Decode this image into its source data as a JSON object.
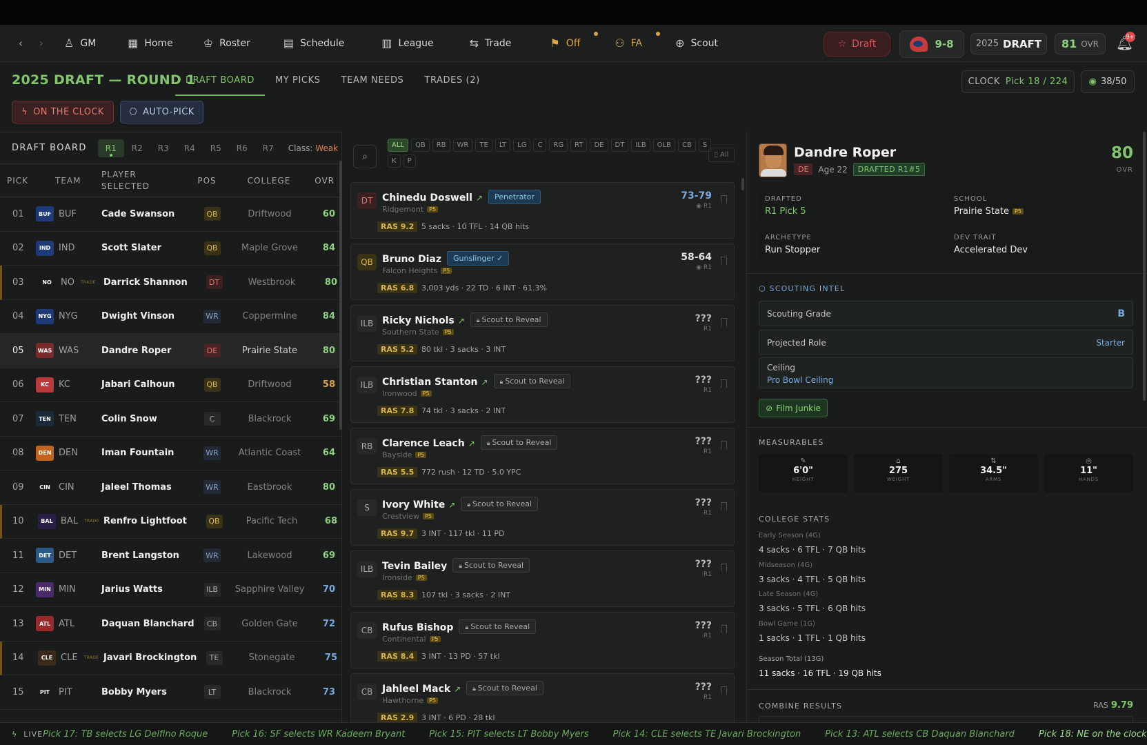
{
  "nav": {
    "gm": "GM",
    "home": "Home",
    "roster": "Roster",
    "schedule": "Schedule",
    "league": "League",
    "trade": "Trade",
    "off": "Off",
    "fa": "FA",
    "scout": "Scout",
    "draft": "Draft",
    "record": "9-8",
    "year": "2025",
    "year_label": "DRAFT",
    "ovr": "81",
    "ovr_label": "OVR",
    "notif_badge": "9+"
  },
  "header": {
    "title": "2025 DRAFT — ROUND 1",
    "tabs": [
      "DRAFT BOARD",
      "MY PICKS",
      "TEAM NEEDS",
      "TRADES (2)"
    ],
    "clock_label": "CLOCK",
    "clock_value": "Pick 18 / 224",
    "watch": "38/50",
    "on_clock": "ON THE CLOCK",
    "auto_pick": "AUTO-PICK"
  },
  "board": {
    "title": "DRAFT BOARD",
    "rounds": [
      "R1",
      "R2",
      "R3",
      "R4",
      "R5",
      "R6",
      "R7"
    ],
    "class_label": "Class:",
    "class_value": "Weak",
    "columns": [
      "PICK",
      "TEAM",
      "PLAYER SELECTED",
      "POS",
      "COLLEGE",
      "OVR"
    ],
    "trade_tag": "TRADE",
    "picks": [
      {
        "pick": "01",
        "team": "BUF",
        "player": "Cade Swanson",
        "pos": "QB",
        "college": "Driftwood",
        "ovr": "60",
        "color": "#1f3a78",
        "ovr_color": "#8dcf7e"
      },
      {
        "pick": "02",
        "team": "IND",
        "player": "Scott Slater",
        "pos": "QB",
        "college": "Maple Grove",
        "ovr": "84",
        "color": "#1f3a78",
        "ovr_color": "#8dcf7e"
      },
      {
        "pick": "03",
        "team": "NO",
        "player": "Darrick Shannon",
        "pos": "DT",
        "college": "Westbrook",
        "ovr": "80",
        "color": "#1a1a1a",
        "ovr_color": "#8dcf7e",
        "trade": true
      },
      {
        "pick": "04",
        "team": "NYG",
        "player": "Dwight Vinson",
        "pos": "WR",
        "college": "Coppermine",
        "ovr": "84",
        "color": "#1f3a78",
        "ovr_color": "#8dcf7e"
      },
      {
        "pick": "05",
        "team": "WAS",
        "player": "Dandre Roper",
        "pos": "DE",
        "college": "Prairie State",
        "ovr": "80",
        "color": "#7a2a2a",
        "ovr_color": "#8dcf7e",
        "selected": true
      },
      {
        "pick": "06",
        "team": "KC",
        "player": "Jabari Calhoun",
        "pos": "QB",
        "college": "Driftwood",
        "ovr": "58",
        "color": "#b83a3a",
        "ovr_color": "#d9a64a"
      },
      {
        "pick": "07",
        "team": "TEN",
        "player": "Colin Snow",
        "pos": "C",
        "college": "Blackrock",
        "ovr": "69",
        "color": "#1a2a3a",
        "ovr_color": "#8dcf7e"
      },
      {
        "pick": "08",
        "team": "DEN",
        "player": "Iman Fountain",
        "pos": "WR",
        "college": "Atlantic Coast",
        "ovr": "64",
        "color": "#c4621e",
        "ovr_color": "#8dcf7e"
      },
      {
        "pick": "09",
        "team": "CIN",
        "player": "Jaleel Thomas",
        "pos": "WR",
        "college": "Eastbrook",
        "ovr": "80",
        "color": "#1a1a1a",
        "ovr_color": "#8dcf7e"
      },
      {
        "pick": "10",
        "team": "BAL",
        "player": "Renfro Lightfoot",
        "pos": "QB",
        "college": "Pacific Tech",
        "ovr": "68",
        "color": "#2b1f4a",
        "ovr_color": "#8dcf7e",
        "trade": true
      },
      {
        "pick": "11",
        "team": "DET",
        "player": "Brent Langston",
        "pos": "WR",
        "college": "Lakewood",
        "ovr": "69",
        "color": "#2a5a85",
        "ovr_color": "#8dcf7e"
      },
      {
        "pick": "12",
        "team": "MIN",
        "player": "Jarius Watts",
        "pos": "ILB",
        "college": "Sapphire Valley",
        "ovr": "70",
        "color": "#4a2a6a",
        "ovr_color": "#78a9dc"
      },
      {
        "pick": "13",
        "team": "ATL",
        "player": "Daquan Blanchard",
        "pos": "CB",
        "college": "Golden Gate",
        "ovr": "72",
        "color": "#9a2a2a",
        "ovr_color": "#78a9dc"
      },
      {
        "pick": "14",
        "team": "CLE",
        "player": "Javari Brockington",
        "pos": "TE",
        "college": "Stonegate",
        "ovr": "75",
        "color": "#3a2a1a",
        "ovr_color": "#78a9dc",
        "trade": true
      },
      {
        "pick": "15",
        "team": "PIT",
        "player": "Bobby Myers",
        "pos": "LT",
        "college": "Blackrock",
        "ovr": "73",
        "color": "#1a1a1a",
        "ovr_color": "#78a9dc"
      }
    ]
  },
  "filters": {
    "positions": [
      "ALL",
      "QB",
      "RB",
      "WR",
      "TE",
      "LT",
      "LG",
      "C",
      "RG",
      "RT",
      "DE",
      "DT",
      "ILB",
      "OLB",
      "CB",
      "S",
      "K",
      "P"
    ],
    "all_label": "All"
  },
  "prospects": [
    {
      "pos": "DT",
      "name": "Chinedu Doswell",
      "tag": "Penetrator",
      "tag_type": "blue",
      "school": "Ridgemont",
      "ras": "RAS 9.2",
      "stats": "5 sacks · 10 TFL · 14 QB hits",
      "range": "73-79",
      "range_color": "#78a9dc",
      "round": "R1",
      "trend": true
    },
    {
      "pos": "QB",
      "name": "Bruno Diaz",
      "tag": "Gunslinger ✓",
      "tag_type": "blue",
      "school": "Falcon Heights",
      "ras": "RAS 6.8",
      "stats": "3,003 yds · 22 TD · 6 INT · 61.3%",
      "range": "58-64",
      "range_color": "#e0e0dc",
      "round": "R1",
      "trend": false
    },
    {
      "pos": "ILB",
      "name": "Ricky Nichols",
      "tag": "Scout to Reveal",
      "tag_type": "scout",
      "school": "Southern State",
      "ras": "RAS 5.2",
      "stats": "80 tkl · 3 sacks · 3 INT",
      "range": "???",
      "range_color": "#b9bbb6",
      "round": "R1",
      "trend": true
    },
    {
      "pos": "ILB",
      "name": "Christian Stanton",
      "tag": "Scout to Reveal",
      "tag_type": "scout",
      "school": "Ironwood",
      "ras": "RAS 7.8",
      "stats": "74 tkl · 3 sacks · 2 INT",
      "range": "???",
      "range_color": "#b9bbb6",
      "round": "R1",
      "trend": true
    },
    {
      "pos": "RB",
      "name": "Clarence Leach",
      "tag": "Scout to Reveal",
      "tag_type": "scout",
      "school": "Bayside",
      "ras": "RAS 5.5",
      "stats": "772 rush · 12 TD · 5.0 YPC",
      "range": "???",
      "range_color": "#b9bbb6",
      "round": "R1",
      "trend": true
    },
    {
      "pos": "S",
      "name": "Ivory White",
      "tag": "Scout to Reveal",
      "tag_type": "scout",
      "school": "Crestview",
      "ras": "RAS 9.7",
      "stats": "3 INT · 117 tkl · 11 PD",
      "range": "???",
      "range_color": "#b9bbb6",
      "round": "R1",
      "trend": true
    },
    {
      "pos": "ILB",
      "name": "Tevin Bailey",
      "tag": "Scout to Reveal",
      "tag_type": "scout",
      "school": "Ironside",
      "ras": "RAS 8.3",
      "stats": "107 tkl · 3 sacks · 2 INT",
      "range": "???",
      "range_color": "#b9bbb6",
      "round": "R1",
      "trend": false
    },
    {
      "pos": "CB",
      "name": "Rufus Bishop",
      "tag": "Scout to Reveal",
      "tag_type": "scout",
      "school": "Continental",
      "ras": "RAS 8.4",
      "stats": "3 INT · 13 PD · 57 tkl",
      "range": "???",
      "range_color": "#b9bbb6",
      "round": "R1",
      "trend": false
    },
    {
      "pos": "CB",
      "name": "Jahleel Mack",
      "tag": "Scout to Reveal",
      "tag_type": "scout",
      "school": "Hawthorne",
      "ras": "RAS 2.9",
      "stats": "3 INT · 6 PD · 28 tkl",
      "range": "???",
      "range_color": "#b9bbb6",
      "round": "R1",
      "trend": true
    }
  ],
  "p5_label": "P5",
  "player": {
    "name": "Dandre Roper",
    "pos": "DE",
    "age": "Age 22",
    "drafted_badge": "DRAFTED R1#5",
    "ovr": "80",
    "ovr_label": "OVR",
    "drafted_label": "DRAFTED",
    "drafted_value": "R1 Pick 5",
    "school_label": "SCHOOL",
    "school_value": "Prairie State",
    "archetype_label": "ARCHETYPE",
    "archetype_value": "Run Stopper",
    "dev_label": "DEV TRAIT",
    "dev_value": "Accelerated Dev",
    "scouting_title": "SCOUTING INTEL",
    "grade_label": "Scouting Grade",
    "grade_value": "B",
    "role_label": "Projected Role",
    "role_value": "Starter",
    "ceiling_label": "Ceiling",
    "ceiling_value": "Pro Bowl Ceiling",
    "trait_badge": "Film Junkie",
    "measurables_title": "MEASURABLES",
    "measurables": [
      {
        "icon": "ruler-icon",
        "glyph": "✎",
        "value": "6'0\"",
        "label": "HEIGHT"
      },
      {
        "icon": "weight-icon",
        "glyph": "⌂",
        "value": "275",
        "label": "WEIGHT"
      },
      {
        "icon": "arms-icon",
        "glyph": "⇅",
        "value": "34.5\"",
        "label": "ARMS"
      },
      {
        "icon": "hands-icon",
        "glyph": "◎",
        "value": "11\"",
        "label": "HANDS"
      }
    ],
    "college_title": "COLLEGE STATS",
    "college": [
      {
        "label": "Early Season (4G)",
        "value": "4 sacks · 6 TFL · 7 QB hits"
      },
      {
        "label": "Midseason (4G)",
        "value": "3 sacks · 4 TFL · 5 QB hits"
      },
      {
        "label": "Late Season (4G)",
        "value": "3 sacks · 5 TFL · 6 QB hits"
      },
      {
        "label": "Bowl Game (1G)",
        "value": "1 sacks · 1 TFL · 1 QB hits"
      },
      {
        "label": "Season Total (13G)",
        "value": "11 sacks · 16 TFL · 19 QB hits"
      }
    ],
    "combine_title": "COMBINE RESULTS",
    "combine_ras_label": "RAS",
    "combine_ras_value": "9.79"
  },
  "ticker": {
    "live": "LIVE",
    "items": [
      "Pick 17: TB selects LG Delfino Roque",
      "Pick 16: SF selects WR Kadeem Bryant",
      "Pick 15: PIT selects LT Bobby Myers",
      "Pick 14: CLE selects TE Javari Brockington",
      "Pick 13: ATL selects CB Daquan Blanchard",
      "Pick 18: NE on the clock..."
    ]
  },
  "colors": {
    "accent": "#82c56d",
    "danger": "#e0585a",
    "blue": "#78a9dc"
  }
}
